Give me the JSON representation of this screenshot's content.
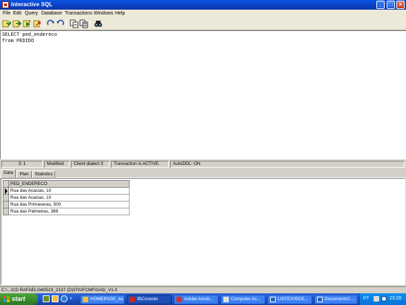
{
  "window": {
    "title": "Interactive SQL",
    "controls": {
      "minimize": "_",
      "maximize": "□",
      "close": "×"
    }
  },
  "menu": [
    "File",
    "Edit",
    "Query",
    "Database",
    "Transactions",
    "Windows",
    "Help"
  ],
  "toolbar": {
    "icons": [
      "prev-query-icon",
      "next-query-icon",
      "execute-query-icon",
      "undo-icon",
      "redo-icon",
      "commit-icon",
      "rollback-icon",
      "find-icon"
    ]
  },
  "editor": {
    "sql_text": "SELECT ped_endereco\nfrom PEDIDO"
  },
  "status": {
    "position": "3:   1",
    "modified": "Modified",
    "dialect": "Client dialect 3",
    "transaction": "Transaction is ACTIVE.",
    "autoddl": "AutoDDL: ON"
  },
  "tabs": [
    "Data",
    "Plan",
    "Statistics"
  ],
  "grid": {
    "column_header": "PED_ENDERECO",
    "rows": [
      "Rua das Acacias, 10",
      "Rua das Acacias, 10",
      "Rua das Primaveras, 500",
      "Rua das Palmeiras, 389"
    ]
  },
  "path_bar": "C:\\...\\CD RAFAEL\\040519_2137 (D)\\ITA\\FCMF\\GAD_V1.0",
  "taskbar": {
    "start_label": "start",
    "tasks": [
      "HOMEPAGE_ita",
      "IBConsole",
      "Adobe Acrob...",
      "Computer As...",
      "LISTEX05CE...",
      "Documento1 ...",
      "Interactive..."
    ],
    "language": "PT",
    "clock": "23:20"
  },
  "colors": {
    "titlebar": "#0a54e3",
    "taskbar": "#245edb",
    "start_button": "#3c8f30"
  }
}
